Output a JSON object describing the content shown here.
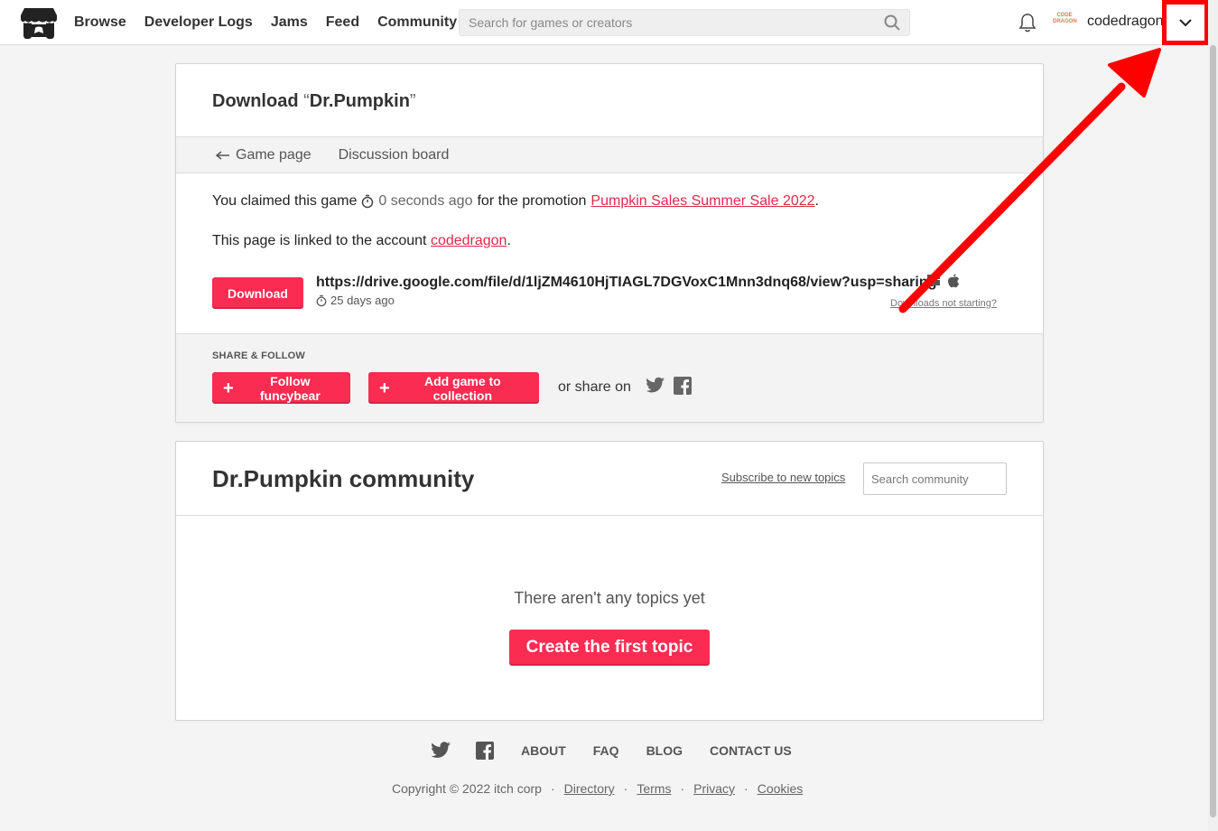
{
  "header": {
    "nav": [
      "Browse",
      "Developer Logs",
      "Jams",
      "Feed",
      "Community"
    ],
    "search_placeholder": "Search for games or creators",
    "avatar_text": "CODE DRAGON",
    "username": "codedragon"
  },
  "download": {
    "title_prefix": "Download ",
    "open_quote": "“",
    "game_name": "Dr.Pumpkin",
    "close_quote": "”",
    "tabs": {
      "game_page": "Game page",
      "discussion": "Discussion board"
    },
    "claim_text": "You claimed this game",
    "claim_time": "0 seconds ago",
    "claim_promo_text": "for the promotion",
    "promo_name": "Pumpkin Sales Summer Sale 2022",
    "period": ".",
    "linked_text": "This page is linked to the account",
    "linked_account": "codedragon",
    "download_label": "Download",
    "file_url": "https://drive.google.com/file/d/1ljZM4610HjTIAGL7DGVoxC1Mnn3dnq68/view?usp=sharing",
    "file_age": "25 days ago",
    "not_starting": "Downloads not starting?",
    "share_title": "SHARE & FOLLOW",
    "follow_label": "Follow funcybear",
    "collection_label": "Add game to collection",
    "share_on": "or share on"
  },
  "community": {
    "title": "Dr.Pumpkin community",
    "subscribe": "Subscribe to new topics",
    "search_placeholder": "Search community",
    "empty_text": "There aren't any topics yet",
    "create_label": "Create the first topic"
  },
  "footer": {
    "links": [
      "ABOUT",
      "FAQ",
      "BLOG",
      "CONTACT US"
    ],
    "copyright": "Copyright © 2022 itch corp",
    "sep": "·",
    "legal": [
      "Directory",
      "Terms",
      "Privacy",
      "Cookies"
    ]
  },
  "colors": {
    "accent": "#fa2c52",
    "link": "#da2c49",
    "annotation": "#ff0000"
  }
}
